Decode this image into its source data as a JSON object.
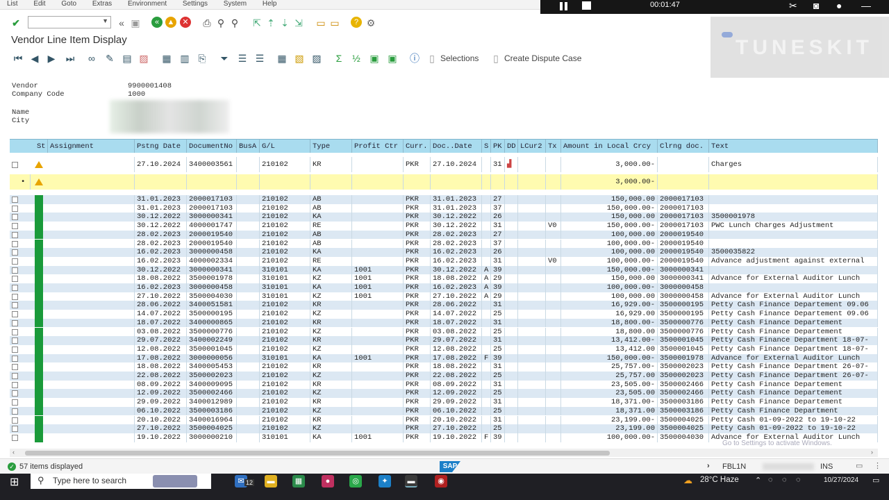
{
  "menu": [
    "List",
    "Edit",
    "Goto",
    "Extras",
    "Environment",
    "Settings",
    "System",
    "Help"
  ],
  "recorder": {
    "time": "00:01:47"
  },
  "page_title": "Vendor Line Item Display",
  "toolbar": {
    "selections": "Selections",
    "create_dispute": "Create Dispute Case"
  },
  "watermark": "TUNESKIT",
  "header": {
    "vendor_label": "Vendor",
    "vendor_value": "9900001408",
    "company_label": "Company Code",
    "company_value": "1000",
    "name_label": "Name",
    "city_label": "City"
  },
  "columns": [
    "St",
    "Assignment",
    "Pstng Date",
    "DocumentNo",
    "BusA",
    "G/L",
    "Type",
    "Profit Ctr",
    "Curr.",
    "Doc..Date",
    "S",
    "PK",
    "DD",
    "LCur2",
    "Tx",
    "Amount in Local Crcy",
    "Clrng doc.",
    "Text"
  ],
  "open_item": {
    "pstng": "27.10.2024",
    "doc": "3400003561",
    "gl": "210102",
    "type": "KR",
    "curr": "PKR",
    "docdate": "27.10.2024",
    "pk": "31",
    "amount": "3,000.00-",
    "text": "Charges"
  },
  "subtotal": {
    "marker": "•",
    "amount": "3,000.00-"
  },
  "rows": [
    [
      "31.01.2023",
      "2000017103",
      "210102",
      "AB",
      "",
      "PKR",
      "31.01.2023",
      "",
      "27",
      "",
      "150,000.00",
      "2000017103",
      ""
    ],
    [
      "31.01.2023",
      "2000017103",
      "210102",
      "AB",
      "",
      "PKR",
      "31.01.2023",
      "",
      "37",
      "",
      "150,000.00-",
      "2000017103",
      ""
    ],
    [
      "30.12.2022",
      "3000000341",
      "210102",
      "KA",
      "",
      "PKR",
      "30.12.2022",
      "",
      "26",
      "",
      "150,000.00",
      "2000017103",
      "3500001978"
    ],
    [
      "30.12.2022",
      "4000001747",
      "210102",
      "RE",
      "",
      "PKR",
      "30.12.2022",
      "",
      "31",
      "V0",
      "150,000.00-",
      "2000017103",
      "PWC Lunch Charges Adjustment"
    ],
    [
      "28.02.2023",
      "2000019540",
      "210102",
      "AB",
      "",
      "PKR",
      "28.02.2023",
      "",
      "27",
      "",
      "100,000.00",
      "2000019540",
      ""
    ],
    [
      "28.02.2023",
      "2000019540",
      "210102",
      "AB",
      "",
      "PKR",
      "28.02.2023",
      "",
      "37",
      "",
      "100,000.00-",
      "2000019540",
      ""
    ],
    [
      "16.02.2023",
      "3000000458",
      "210102",
      "KA",
      "",
      "PKR",
      "16.02.2023",
      "",
      "26",
      "",
      "100,000.00",
      "2000019540",
      "3500035822"
    ],
    [
      "16.02.2023",
      "4000002334",
      "210102",
      "RE",
      "",
      "PKR",
      "16.02.2023",
      "",
      "31",
      "V0",
      "100,000.00-",
      "2000019540",
      "Advance adjustment against external"
    ],
    [
      "30.12.2022",
      "3000000341",
      "310101",
      "KA",
      "1001",
      "PKR",
      "30.12.2022",
      "A",
      "39",
      "",
      "150,000.00-",
      "3000000341",
      ""
    ],
    [
      "18.08.2022",
      "3500001978",
      "310101",
      "KZ",
      "1001",
      "PKR",
      "18.08.2022",
      "A",
      "29",
      "",
      "150,000.00",
      "3000000341",
      "Advance for External Auditor Lunch"
    ],
    [
      "16.02.2023",
      "3000000458",
      "310101",
      "KA",
      "1001",
      "PKR",
      "16.02.2023",
      "A",
      "39",
      "",
      "100,000.00-",
      "3000000458",
      ""
    ],
    [
      "27.10.2022",
      "3500004030",
      "310101",
      "KZ",
      "1001",
      "PKR",
      "27.10.2022",
      "A",
      "29",
      "",
      "100,000.00",
      "3000000458",
      "Advance for External Auditor Lunch"
    ],
    [
      "28.06.2022",
      "3400051581",
      "210102",
      "KR",
      "",
      "PKR",
      "28.06.2022",
      "",
      "31",
      "",
      "16,929.00-",
      "3500000195",
      "Petty Cash Finance Departement 09.06"
    ],
    [
      "14.07.2022",
      "3500000195",
      "210102",
      "KZ",
      "",
      "PKR",
      "14.07.2022",
      "",
      "25",
      "",
      "16,929.00",
      "3500000195",
      "Petty Cash Finance Departement 09.06"
    ],
    [
      "18.07.2022",
      "3400000865",
      "210102",
      "KR",
      "",
      "PKR",
      "18.07.2022",
      "",
      "31",
      "",
      "18,800.00-",
      "3500000776",
      "Petty Cash Finance Departement"
    ],
    [
      "03.08.2022",
      "3500000776",
      "210102",
      "KZ",
      "",
      "PKR",
      "03.08.2022",
      "",
      "25",
      "",
      "18,800.00",
      "3500000776",
      "Petty Cash Finance Departement"
    ],
    [
      "29.07.2022",
      "3400002249",
      "210102",
      "KR",
      "",
      "PKR",
      "29.07.2022",
      "",
      "31",
      "",
      "13,412.00-",
      "3500001045",
      "Petty Cash Finance Department 18-07-"
    ],
    [
      "12.08.2022",
      "3500001045",
      "210102",
      "KZ",
      "",
      "PKR",
      "12.08.2022",
      "",
      "25",
      "",
      "13,412.00",
      "3500001045",
      "Petty Cash Finance Department 18-07-"
    ],
    [
      "17.08.2022",
      "3000000056",
      "310101",
      "KA",
      "1001",
      "PKR",
      "17.08.2022",
      "F",
      "39",
      "",
      "150,000.00-",
      "3500001978",
      "Advance for External Auditor Lunch"
    ],
    [
      "18.08.2022",
      "3400005453",
      "210102",
      "KR",
      "",
      "PKR",
      "18.08.2022",
      "",
      "31",
      "",
      "25,757.00-",
      "3500002023",
      "Petty Cash Finance Department 26-07-"
    ],
    [
      "22.08.2022",
      "3500002023",
      "210102",
      "KZ",
      "",
      "PKR",
      "22.08.2022",
      "",
      "25",
      "",
      "25,757.00",
      "3500002023",
      "Petty Cash Finance Department 26-07-"
    ],
    [
      "08.09.2022",
      "3400009095",
      "210102",
      "KR",
      "",
      "PKR",
      "08.09.2022",
      "",
      "31",
      "",
      "23,505.00-",
      "3500002466",
      "Petty Cash Finance Departement"
    ],
    [
      "12.09.2022",
      "3500002466",
      "210102",
      "KZ",
      "",
      "PKR",
      "12.09.2022",
      "",
      "25",
      "",
      "23,505.00",
      "3500002466",
      "Petty Cash Finance Departement"
    ],
    [
      "29.09.2022",
      "3400012989",
      "210102",
      "KR",
      "",
      "PKR",
      "29.09.2022",
      "",
      "31",
      "",
      "18,371.00-",
      "3500003186",
      "Petty Cash Finance Departement"
    ],
    [
      "06.10.2022",
      "3500003186",
      "210102",
      "KZ",
      "",
      "PKR",
      "06.10.2022",
      "",
      "25",
      "",
      "18,371.00",
      "3500003186",
      "Petty Cash Finance Department"
    ],
    [
      "20.10.2022",
      "3400016964",
      "210102",
      "KR",
      "",
      "PKR",
      "20.10.2022",
      "",
      "31",
      "",
      "23,199.00-",
      "3500004025",
      "Petty Cash 01-09-2022 to 19-10-22"
    ],
    [
      "27.10.2022",
      "3500004025",
      "210102",
      "KZ",
      "",
      "PKR",
      "27.10.2022",
      "",
      "25",
      "",
      "23,199.00",
      "3500004025",
      "Petty Cash 01-09-2022 to 19-10-22"
    ],
    [
      "19.10.2022",
      "3000000210",
      "310101",
      "KA",
      "1001",
      "PKR",
      "19.10.2022",
      "F",
      "39",
      "",
      "100,000.00-",
      "3500004030",
      "Advance for External Auditor Lunch"
    ]
  ],
  "status": {
    "message": "57 items displayed",
    "transaction": "FBL1N",
    "mode": "INS"
  },
  "windows_note": "Go to Settings to activate Windows.",
  "taskbar": {
    "search": "Type here to search",
    "weather": "28°C  Haze",
    "date": "10/27/2024",
    "badge": "12"
  },
  "colors": {
    "header_bg": "#a9dcef",
    "row_alt": "#dce8f3",
    "subtotal": "#fffbb0",
    "status_green": "#1a9a3a",
    "warning": "#e8a400"
  }
}
